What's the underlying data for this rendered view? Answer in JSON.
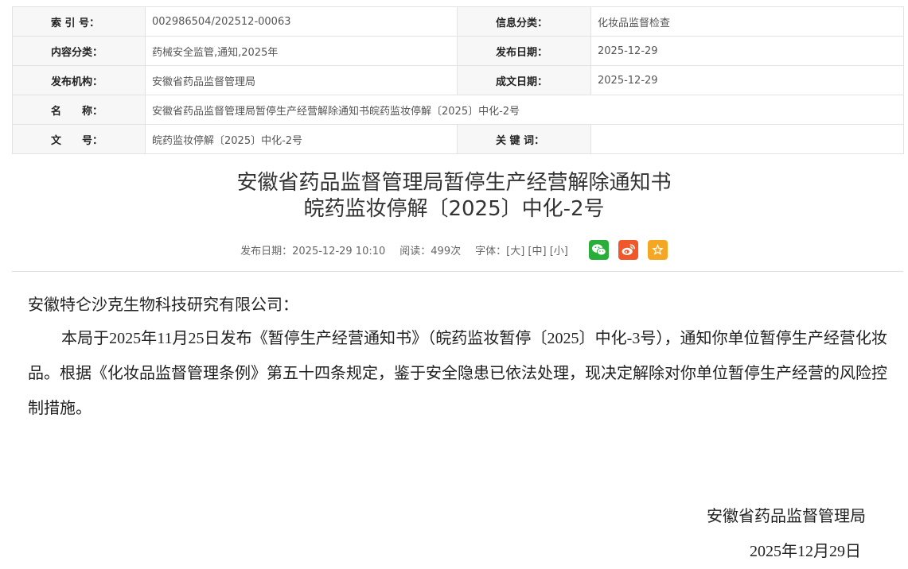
{
  "meta": {
    "rows": [
      {
        "l1": "索 引 号：",
        "v1": "002986504/202512-00063",
        "l2": "信息分类：",
        "v2": "化妆品监督检查"
      },
      {
        "l1": "内容分类：",
        "v1": "药械安全监管,通知,2025年",
        "l2": "发布日期：",
        "v2": "2025-12-29"
      },
      {
        "l1": "发布机构：",
        "v1": "安徽省药品监督管理局",
        "l2": "成文日期：",
        "v2": "2025-12-29"
      },
      {
        "l1": "名　　称：",
        "v1": "安徽省药品监督管理局暂停生产经营解除通知书皖药监妆停解〔2025〕中化-2号"
      },
      {
        "l1": "文　　号：",
        "v1": "皖药监妆停解〔2025〕中化-2号",
        "l2": "关 键 词：",
        "v2": ""
      }
    ]
  },
  "article": {
    "title_line1": "安徽省药品监督管理局暂停生产经营解除通知书",
    "title_line2": "皖药监妆停解〔2025〕中化-2号",
    "info": {
      "publish": "发布日期：2025-12-29 10:10",
      "reads": "阅读：499次",
      "font_label": "字体：",
      "font_large": "[大]",
      "font_medium": "[中]",
      "font_small": "[小]"
    },
    "share": [
      {
        "icon": "wechat-icon",
        "color": "#2aae3a"
      },
      {
        "icon": "weibo-icon",
        "color": "#f0572a"
      },
      {
        "icon": "favorite-star-icon",
        "color": "#f5a623"
      }
    ],
    "salutation": "安徽特仑沙克生物科技研究有限公司：",
    "paragraph": "本局于2025年11月25日发布《暂停生产经营通知书》（皖药监妆暂停〔2025〕中化-3号），通知你单位暂停生产经营化妆品。根据《化妆品监督管理条例》第五十四条规定，鉴于安全隐患已依法处理，现决定解除对你单位暂停生产经营的风险控制措施。",
    "signature_org": "安徽省药品监督管理局",
    "signature_date": "2025年12月29日"
  }
}
